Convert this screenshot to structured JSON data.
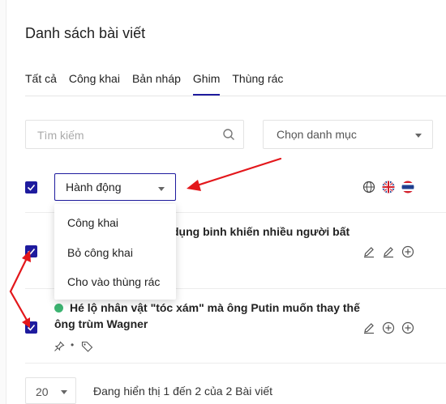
{
  "page_title": "Danh sách bài viết",
  "tabs": [
    {
      "label": "Tất cả"
    },
    {
      "label": "Công khai"
    },
    {
      "label": "Bản nháp"
    },
    {
      "label": "Ghim",
      "active": true
    },
    {
      "label": "Thùng rác"
    }
  ],
  "search": {
    "placeholder": "Tìm kiếm"
  },
  "category_select": {
    "label": "Chọn danh mục"
  },
  "bulk_action": {
    "label": "Hành động"
  },
  "dropdown": {
    "items": [
      "Công khai",
      "Bỏ công khai",
      "Cho vào thùng rác"
    ]
  },
  "languages": [
    "globe-icon",
    "flag-uk-icon",
    "flag-th-icon"
  ],
  "posts": [
    {
      "title_visible": "dụng binh khiến nhiều người bất",
      "checked": true
    },
    {
      "title_line1": "Hé lộ nhân vật \"tóc xám\" mà ông Putin muốn thay thế",
      "title_line2": "ông trùm Wagner",
      "status_color": "#3cb371",
      "checked": true,
      "meta_separator": "•"
    }
  ],
  "pagination": {
    "page_size": "20",
    "summary": "Đang hiển thị 1 đến 2 của 2 Bài viết"
  },
  "colors": {
    "accent": "#1e1b9e",
    "annotation": "#e3171b",
    "status_green": "#3cb371"
  }
}
